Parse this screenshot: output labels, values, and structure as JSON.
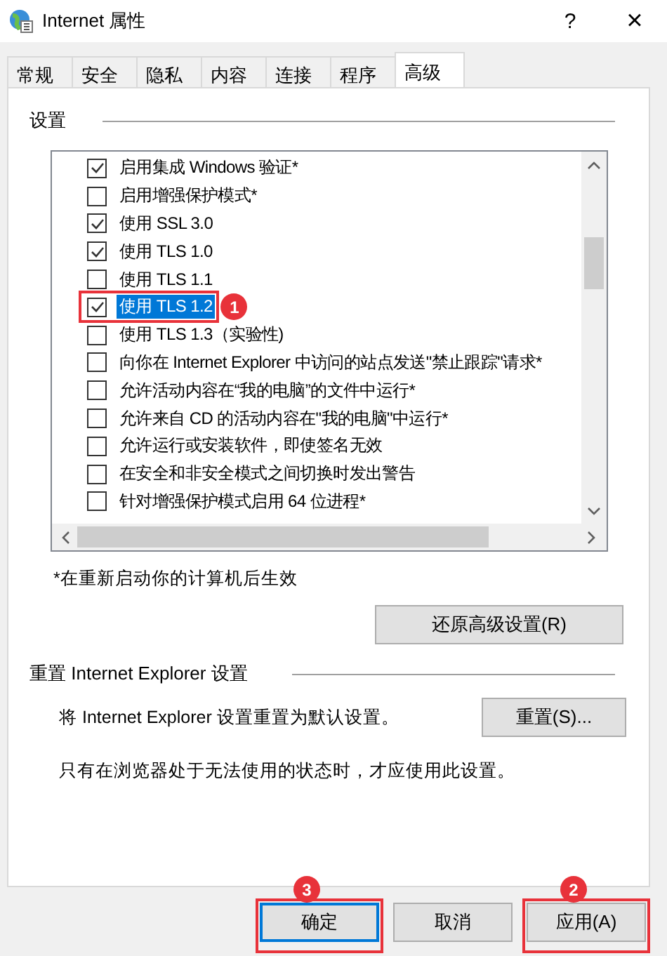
{
  "window": {
    "title": "Internet 属性",
    "help": "?",
    "close": "×"
  },
  "tabs": [
    {
      "label": "常规",
      "selected": false
    },
    {
      "label": "安全",
      "selected": false
    },
    {
      "label": "隐私",
      "selected": false
    },
    {
      "label": "内容",
      "selected": false
    },
    {
      "label": "连接",
      "selected": false
    },
    {
      "label": "程序",
      "selected": false
    },
    {
      "label": "高级",
      "selected": true
    }
  ],
  "settings": {
    "title": "设置",
    "items": [
      {
        "label": "启用集成 Windows 验证*",
        "checked": true,
        "selected": false
      },
      {
        "label": "启用增强保护模式*",
        "checked": false,
        "selected": false
      },
      {
        "label": "使用 SSL 3.0",
        "checked": true,
        "selected": false
      },
      {
        "label": "使用 TLS 1.0",
        "checked": true,
        "selected": false
      },
      {
        "label": "使用 TLS 1.1",
        "checked": false,
        "selected": false
      },
      {
        "label": "使用 TLS 1.2",
        "checked": true,
        "selected": true,
        "callout": "1"
      },
      {
        "label": "使用 TLS 1.3（实验性)",
        "checked": false,
        "selected": false
      },
      {
        "label": "向你在 Internet Explorer 中访问的站点发送\"禁止跟踪\"请求*",
        "checked": false,
        "selected": false
      },
      {
        "label": "允许活动内容在“我的电脑”的文件中运行*",
        "checked": false,
        "selected": false
      },
      {
        "label": "允许来自 CD 的活动内容在\"我的电脑\"中运行*",
        "checked": false,
        "selected": false
      },
      {
        "label": "允许运行或安装软件，即使签名无效",
        "checked": false,
        "selected": false
      },
      {
        "label": "在安全和非安全模式之间切换时发出警告",
        "checked": false,
        "selected": false
      },
      {
        "label": "针对增强保护模式启用 64 位进程*",
        "checked": false,
        "selected": false
      }
    ],
    "note": "*在重新启动你的计算机后生效",
    "restore_button": "还原高级设置(R)"
  },
  "reset": {
    "title": "重置 Internet Explorer 设置",
    "description": "将 Internet Explorer 设置重置为默认设置。",
    "button": "重置(S)...",
    "warning": "只有在浏览器处于无法使用的状态时，才应使用此设置。"
  },
  "buttons": [
    {
      "label": "确定",
      "default": true,
      "callout": "3"
    },
    {
      "label": "取消",
      "default": false
    },
    {
      "label": "应用(A)",
      "default": false,
      "callout": "2"
    }
  ]
}
